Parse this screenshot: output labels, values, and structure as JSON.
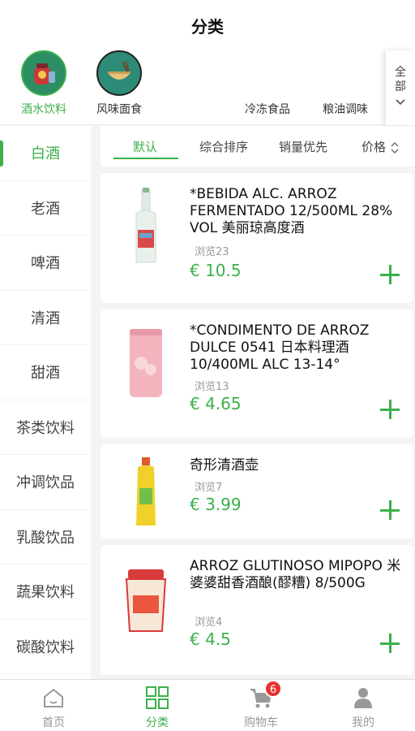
{
  "header": {
    "title": "分类"
  },
  "categories": [
    {
      "label": "酒水饮料",
      "icon": "wine-jar-icon",
      "active": true
    },
    {
      "label": "风味面食",
      "icon": "noodle-bowl-icon",
      "active": false
    },
    {
      "label": "冷冻食品"
    },
    {
      "label": "粮油调味"
    }
  ],
  "all_button": {
    "line1": "全",
    "line2": "部"
  },
  "sidebar": {
    "items": [
      "白酒",
      "老酒",
      "啤酒",
      "清酒",
      "甜酒",
      "茶类饮料",
      "冲调饮品",
      "乳酸饮品",
      "蔬果饮料",
      "碳酸饮料"
    ],
    "active_index": 0
  },
  "sort": {
    "items": [
      "默认",
      "综合排序",
      "销量优先",
      "价格"
    ],
    "active_index": 0
  },
  "products": [
    {
      "name": "*BEBIDA ALC. ARROZ FERMENTADO 12/500ML 28% VOL 美丽琼高度酒",
      "views": "浏览23",
      "price": "€ 10.5",
      "image": "liquor-bottle-icon"
    },
    {
      "name": "*CONDIMENTO DE ARROZ DULCE 0541 日本料理酒 10/400ML  ALC 13-14°",
      "views": "浏览13",
      "price": "€ 4.65",
      "image": "pink-can-icon"
    },
    {
      "name": "奇形清酒壶",
      "views": "浏览7",
      "price": "€ 3.99",
      "image": "yellow-bottle-icon"
    },
    {
      "name": "ARROZ GLUTINOSO MIPOPO 米婆婆甜香酒酿(醪糟) 8/500G",
      "views": "浏览4",
      "price": "€ 4.5",
      "image": "jar-icon"
    }
  ],
  "tabbar": {
    "items": [
      {
        "label": "首页",
        "icon": "home-icon"
      },
      {
        "label": "分类",
        "icon": "grid-icon",
        "active": true
      },
      {
        "label": "购物车",
        "icon": "cart-icon",
        "badge": "6"
      },
      {
        "label": "我的",
        "icon": "user-icon"
      }
    ]
  },
  "colors": {
    "accent": "#3cb04a",
    "badge": "#e5322d"
  }
}
